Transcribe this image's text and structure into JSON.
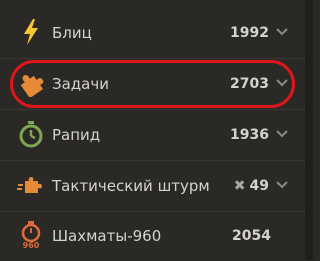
{
  "ratings": [
    {
      "label": "Блиц",
      "value": "1992",
      "icon": "lightning-icon",
      "color": "#f7c631"
    },
    {
      "label": "Задачи",
      "value": "2703",
      "icon": "puzzle-piece-icon",
      "color": "#e58a37"
    },
    {
      "label": "Рапид",
      "value": "1936",
      "icon": "stopwatch-icon",
      "color": "#7fa650"
    },
    {
      "label": "Тактический штурм",
      "value": "49",
      "prefix": "✖",
      "icon": "puzzle-rush-icon",
      "color": "#e58a37"
    },
    {
      "label": "Шахматы-960",
      "value": "2054",
      "icon": "chess960-icon",
      "icon_text": "960",
      "color": "#e26b3b"
    }
  ],
  "highlight_color": "#e0151b"
}
